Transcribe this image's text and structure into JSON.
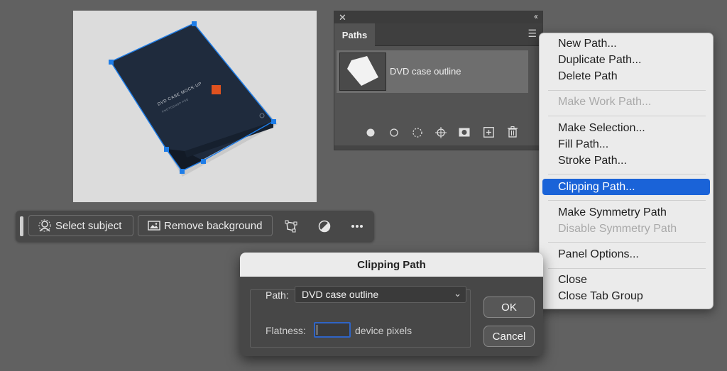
{
  "canvas": {
    "product_title": "DVD CASE MOCK-UP",
    "product_subtitle": "PHOTOSHOP PSD"
  },
  "taskbar": {
    "select_subject_label": "Select subject",
    "remove_background_label": "Remove background",
    "icons": [
      "person-icon",
      "image-icon",
      "transform-icon",
      "adjust-icon",
      "more-icon"
    ]
  },
  "paths_panel": {
    "tab_label": "Paths",
    "path_item": "DVD case outline",
    "footer_icons": [
      "fill-path-icon",
      "stroke-path-icon",
      "selection-path-icon",
      "work-path-icon",
      "mask-icon",
      "new-path-icon",
      "delete-icon"
    ]
  },
  "context_menu": {
    "items": [
      {
        "label": "New Path...",
        "enabled": true
      },
      {
        "label": "Duplicate Path...",
        "enabled": true
      },
      {
        "label": "Delete Path",
        "enabled": true
      },
      {
        "label": "Make Work Path...",
        "enabled": false
      },
      {
        "label": "Make Selection...",
        "enabled": true
      },
      {
        "label": "Fill Path...",
        "enabled": true
      },
      {
        "label": "Stroke Path...",
        "enabled": true
      },
      {
        "label": "Clipping Path...",
        "enabled": true,
        "highlighted": true
      },
      {
        "label": "Make Symmetry Path",
        "enabled": true
      },
      {
        "label": "Disable Symmetry Path",
        "enabled": false
      },
      {
        "label": "Panel Options...",
        "enabled": true
      },
      {
        "label": "Close",
        "enabled": true
      },
      {
        "label": "Close Tab Group",
        "enabled": true
      }
    ]
  },
  "dialog": {
    "title": "Clipping Path",
    "path_label": "Path:",
    "path_value": "DVD case outline",
    "flatness_label": "Flatness:",
    "flatness_value": "",
    "flatness_unit": "device pixels",
    "ok_label": "OK",
    "cancel_label": "Cancel"
  },
  "colors": {
    "accent": "#1a63d8",
    "path_anchor": "#1e7de8",
    "dvd_case": "#1f2b3d",
    "logo_orange": "#e0521f"
  }
}
